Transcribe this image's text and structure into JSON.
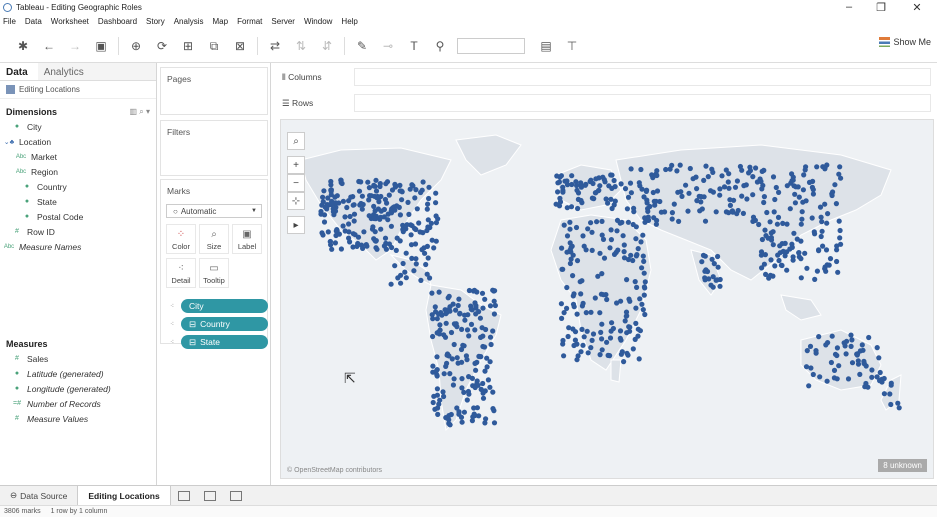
{
  "window": {
    "title": "Tableau - Editing Geographic Roles"
  },
  "menu": [
    "File",
    "Data",
    "Worksheet",
    "Dashboard",
    "Story",
    "Analysis",
    "Map",
    "Format",
    "Server",
    "Window",
    "Help"
  ],
  "toolbar": {
    "show_me_label": "Show Me"
  },
  "left_pane": {
    "tabs": [
      "Data",
      "Analytics"
    ],
    "data_source": "Editing Locations",
    "dimensions_title": "Dimensions",
    "dimensions": [
      {
        "label": "City",
        "icon": "globe-icon"
      },
      {
        "label": "Location",
        "icon": "hierarchy-icon"
      },
      {
        "label": "Market",
        "icon": "abc-icon"
      },
      {
        "label": "Region",
        "icon": "abc-icon"
      },
      {
        "label": "Country",
        "icon": "globe-icon"
      },
      {
        "label": "State",
        "icon": "globe-icon"
      },
      {
        "label": "Postal Code",
        "icon": "globe-icon"
      },
      {
        "label": "Row ID",
        "icon": "number-icon"
      },
      {
        "label": "Measure Names",
        "icon": "abc-icon"
      }
    ],
    "measures_title": "Measures",
    "measures": [
      {
        "label": "Sales",
        "icon": "number-icon"
      },
      {
        "label": "Latitude (generated)",
        "icon": "globe-icon"
      },
      {
        "label": "Longitude (generated)",
        "icon": "globe-icon"
      },
      {
        "label": "Number of Records",
        "icon": "number-icon"
      },
      {
        "label": "Measure Values",
        "icon": "number-icon"
      }
    ]
  },
  "cards": {
    "pages_title": "Pages",
    "filters_title": "Filters",
    "marks_title": "Marks",
    "mark_type": "Automatic",
    "mark_buttons": [
      "Color",
      "Size",
      "Label",
      "Detail",
      "Tooltip"
    ],
    "pills": [
      "City",
      "Country",
      "State"
    ]
  },
  "shelves": {
    "columns_label": "Columns",
    "rows_label": "Rows"
  },
  "map": {
    "attribution": "© OpenStreetMap contributors",
    "unknown_badge": "8 unknown",
    "mark_color": "#2f5a9b",
    "land_color": "#dde2e8",
    "ocean_color": "#eef1f4"
  },
  "sheet_tabs": {
    "data_source_label": "Data Source",
    "active_sheet": "Editing Locations"
  },
  "status": {
    "marks": "3806 marks",
    "rows_cols": "1 row by 1 column"
  },
  "colors": {
    "pill": "#2f97a4",
    "accent": "#e07b39"
  }
}
